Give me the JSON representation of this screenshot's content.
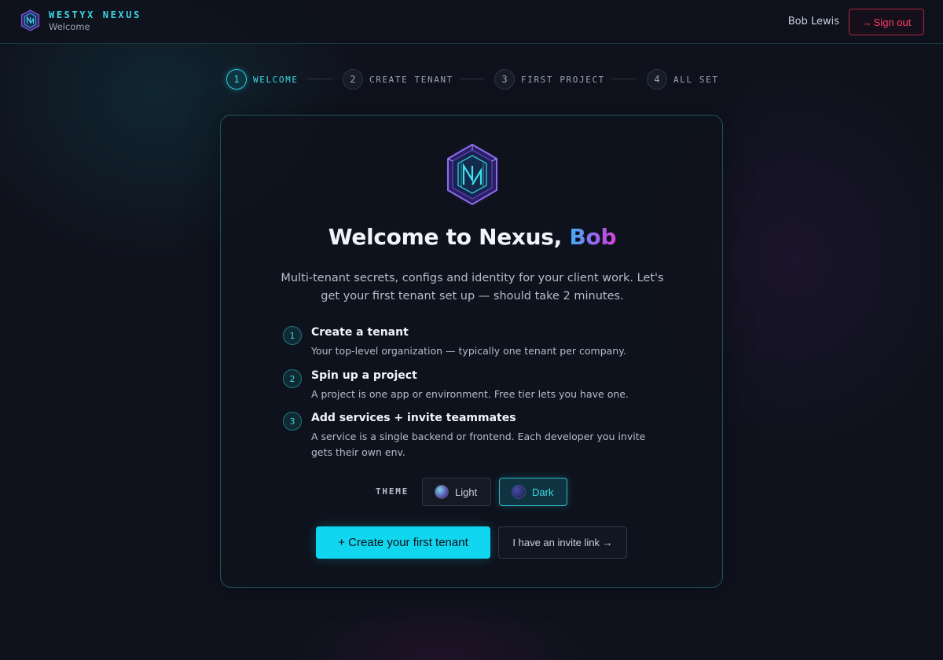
{
  "header": {
    "brand_name": "WESTYX NEXUS",
    "brand_sub": "Welcome",
    "user_name": "Bob Lewis",
    "sign_out_icon": "→",
    "sign_out_label": "Sign out"
  },
  "stepper": {
    "steps": [
      {
        "num": "1",
        "label": "WELCOME",
        "state": "active"
      },
      {
        "num": "2",
        "label": "CREATE TENANT",
        "state": "pending"
      },
      {
        "num": "3",
        "label": "FIRST PROJECT",
        "state": "pending"
      },
      {
        "num": "4",
        "label": "ALL SET",
        "state": "pending"
      }
    ]
  },
  "card": {
    "title_prefix": "Welcome to Nexus, ",
    "title_name": "Bob",
    "intro": "Multi-tenant secrets, configs and identity for your client work. Let's get your first tenant set up — should take 2 minutes.",
    "items": [
      {
        "num": "1",
        "title": "Create a tenant",
        "desc": "Your top-level organization — typically one tenant per company."
      },
      {
        "num": "2",
        "title": "Spin up a project",
        "desc": "A project is one app or environment. Free tier lets you have one."
      },
      {
        "num": "3",
        "title": "Add services + invite teammates",
        "desc": "A service is a single backend or frontend. Each developer you invite gets their own env."
      }
    ],
    "theme": {
      "label": "THEME",
      "options": [
        "Light",
        "Dark"
      ],
      "selected": "Dark"
    },
    "create_button": "+ Create your first tenant",
    "invite_button": "I have an invite link →"
  },
  "colors": {
    "accent": "#11d6ef",
    "danger": "#ff3f62",
    "background": "#0f121d"
  }
}
